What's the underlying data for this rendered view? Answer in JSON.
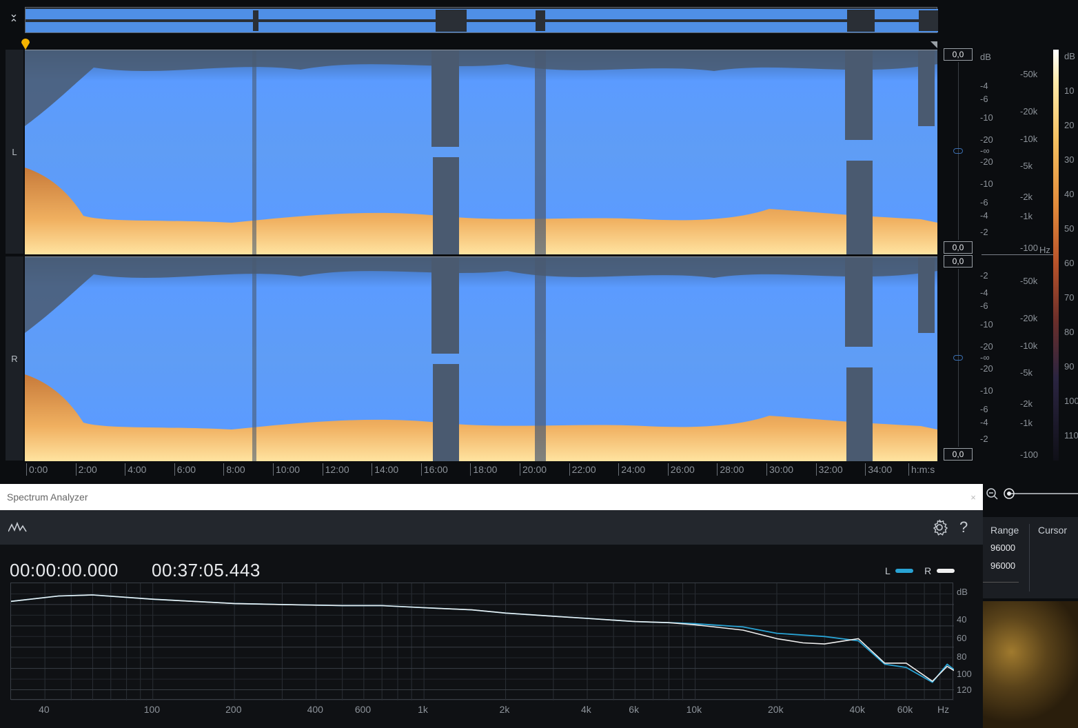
{
  "editor": {
    "channels": [
      "L",
      "R"
    ],
    "db_boxes": [
      "0,0",
      "0,0",
      "0,0",
      "0,0"
    ],
    "amp_scale_l": [
      "dB",
      "-4",
      "-6",
      "-10",
      "-20",
      "-∞",
      "-20",
      "-10",
      "-6",
      "-4",
      "-2"
    ],
    "amp_scale_r": [
      "-2",
      "-4",
      "-6",
      "-10",
      "-20",
      "-∞",
      "-20",
      "-10",
      "-6",
      "-4",
      "-2"
    ],
    "freq_scale_l": [
      "50k",
      "20k",
      "10k",
      "5k",
      "2k",
      "1k",
      "100"
    ],
    "freq_scale_r": [
      "50k",
      "20k",
      "10k",
      "5k",
      "2k",
      "1k",
      "100"
    ],
    "freq_unit": "Hz",
    "color_scale": [
      "dB",
      "10",
      "20",
      "30",
      "40",
      "50",
      "60",
      "70",
      "80",
      "90",
      "100",
      "110"
    ],
    "time_ticks": [
      "0:00",
      "2:00",
      "4:00",
      "6:00",
      "8:00",
      "10:00",
      "12:00",
      "14:00",
      "16:00",
      "18:00",
      "20:00",
      "22:00",
      "24:00",
      "26:00",
      "28:00",
      "30:00",
      "32:00",
      "34:00"
    ],
    "time_unit": "h:m:s"
  },
  "spectrum_analyzer": {
    "title": "Spectrum Analyzer",
    "close_label": "×",
    "help_label": "?",
    "start_time": "00:00:00.000",
    "end_time": "00:37:05.443",
    "legend": [
      {
        "name": "L",
        "color": "#29a3d4"
      },
      {
        "name": "R",
        "color": "#f0f0f0"
      }
    ],
    "db_labels": [
      "dB",
      "40",
      "60",
      "80",
      "100",
      "120"
    ],
    "freq_labels": [
      "40",
      "100",
      "200",
      "400",
      "600",
      "1k",
      "2k",
      "4k",
      "6k",
      "10k",
      "20k",
      "40k",
      "60k",
      "Hz"
    ]
  },
  "selection_panel": {
    "range_label": "Range",
    "cursor_label": "Cursor",
    "values": [
      "96000",
      "96000"
    ]
  },
  "chart_data": {
    "type": "line",
    "xlabel": "Hz",
    "ylabel": "dB",
    "x_scale": "log",
    "x_range": [
      30,
      90000
    ],
    "y_range": [
      -130,
      -20
    ],
    "grid": true,
    "legend_position": "top-right",
    "series": [
      {
        "name": "L",
        "color": "#29a3d4",
        "x": [
          30,
          45,
          60,
          100,
          200,
          300,
          500,
          700,
          1000,
          1500,
          2000,
          3000,
          4000,
          6000,
          8000,
          10000,
          15000,
          20000,
          30000,
          40000,
          50000,
          60000,
          75000,
          85000,
          90000
        ],
        "y": [
          -37,
          -32,
          -31,
          -35,
          -39,
          -40,
          -41,
          -41,
          -43,
          -45,
          -48,
          -51,
          -53,
          -56,
          -57,
          -58,
          -61,
          -67,
          -70,
          -74,
          -96,
          -99,
          -113,
          -96,
          -101
        ]
      },
      {
        "name": "R",
        "color": "#f0f0f0",
        "x": [
          30,
          45,
          60,
          100,
          200,
          300,
          500,
          700,
          1000,
          1500,
          2000,
          3000,
          4000,
          6000,
          8000,
          10000,
          15000,
          20000,
          25000,
          30000,
          40000,
          50000,
          60000,
          75000,
          85000,
          90000
        ],
        "y": [
          -37,
          -32,
          -31,
          -35,
          -39,
          -40,
          -41,
          -41,
          -43,
          -45,
          -48,
          -51,
          -53,
          -56,
          -57,
          -59,
          -64,
          -72,
          -76,
          -77,
          -72,
          -95,
          -95,
          -112,
          -98,
          -102
        ]
      }
    ]
  }
}
